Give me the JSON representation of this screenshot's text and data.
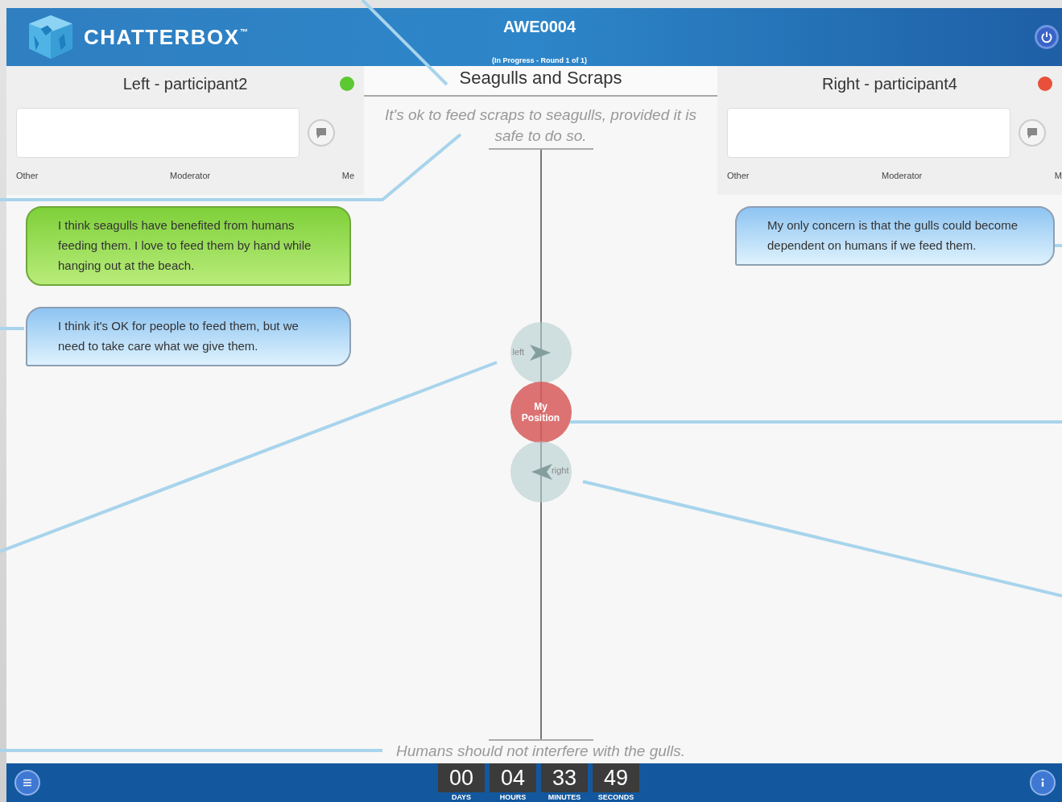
{
  "header": {
    "logo": "CHATTERBOX$^{™}$",
    "session_code": "AWE0004",
    "session_status": "(In Progress - Round 1 of 1)"
  },
  "participants": [
    {
      "title": "Left - participant2",
      "color": "#5cc832",
      "labels": [
        "Other",
        "Moderator",
        "Me"
      ]
    },
    {
      "title": "Right - participant4",
      "color": "#e8503a",
      "labels": [
        "Other",
        "Moderator",
        "M"
      ]
    }
  ],
  "topic": {
    "title": "Seagulls and Scraps",
    "statement_top": "It's ok to feed scraps to seagulls, provided it is safe to do so.",
    "statement_bottom": "Humans should not interfere with the gulls."
  },
  "messages_left": [
    {
      "kind": "me",
      "text": "I think seagulls have benefited from humans feeding them. I love to feed them by hand while hanging out at the beach."
    },
    {
      "kind": "other",
      "text": "I think it's OK for people to feed them, but we need to take care what we give them."
    }
  ],
  "messages_right": [
    {
      "kind": "other",
      "text": "My only concern is that the gulls could become dependent on humans if we feed them."
    }
  ],
  "position": {
    "left_label": "left",
    "marker": "My Position",
    "right_label": "right"
  },
  "timer": [
    {
      "value": "00",
      "label": "DAYS"
    },
    {
      "value": "04",
      "label": "HOURS"
    },
    {
      "value": "33",
      "label": "MINUTES"
    },
    {
      "value": "49",
      "label": "SECONDS"
    }
  ]
}
